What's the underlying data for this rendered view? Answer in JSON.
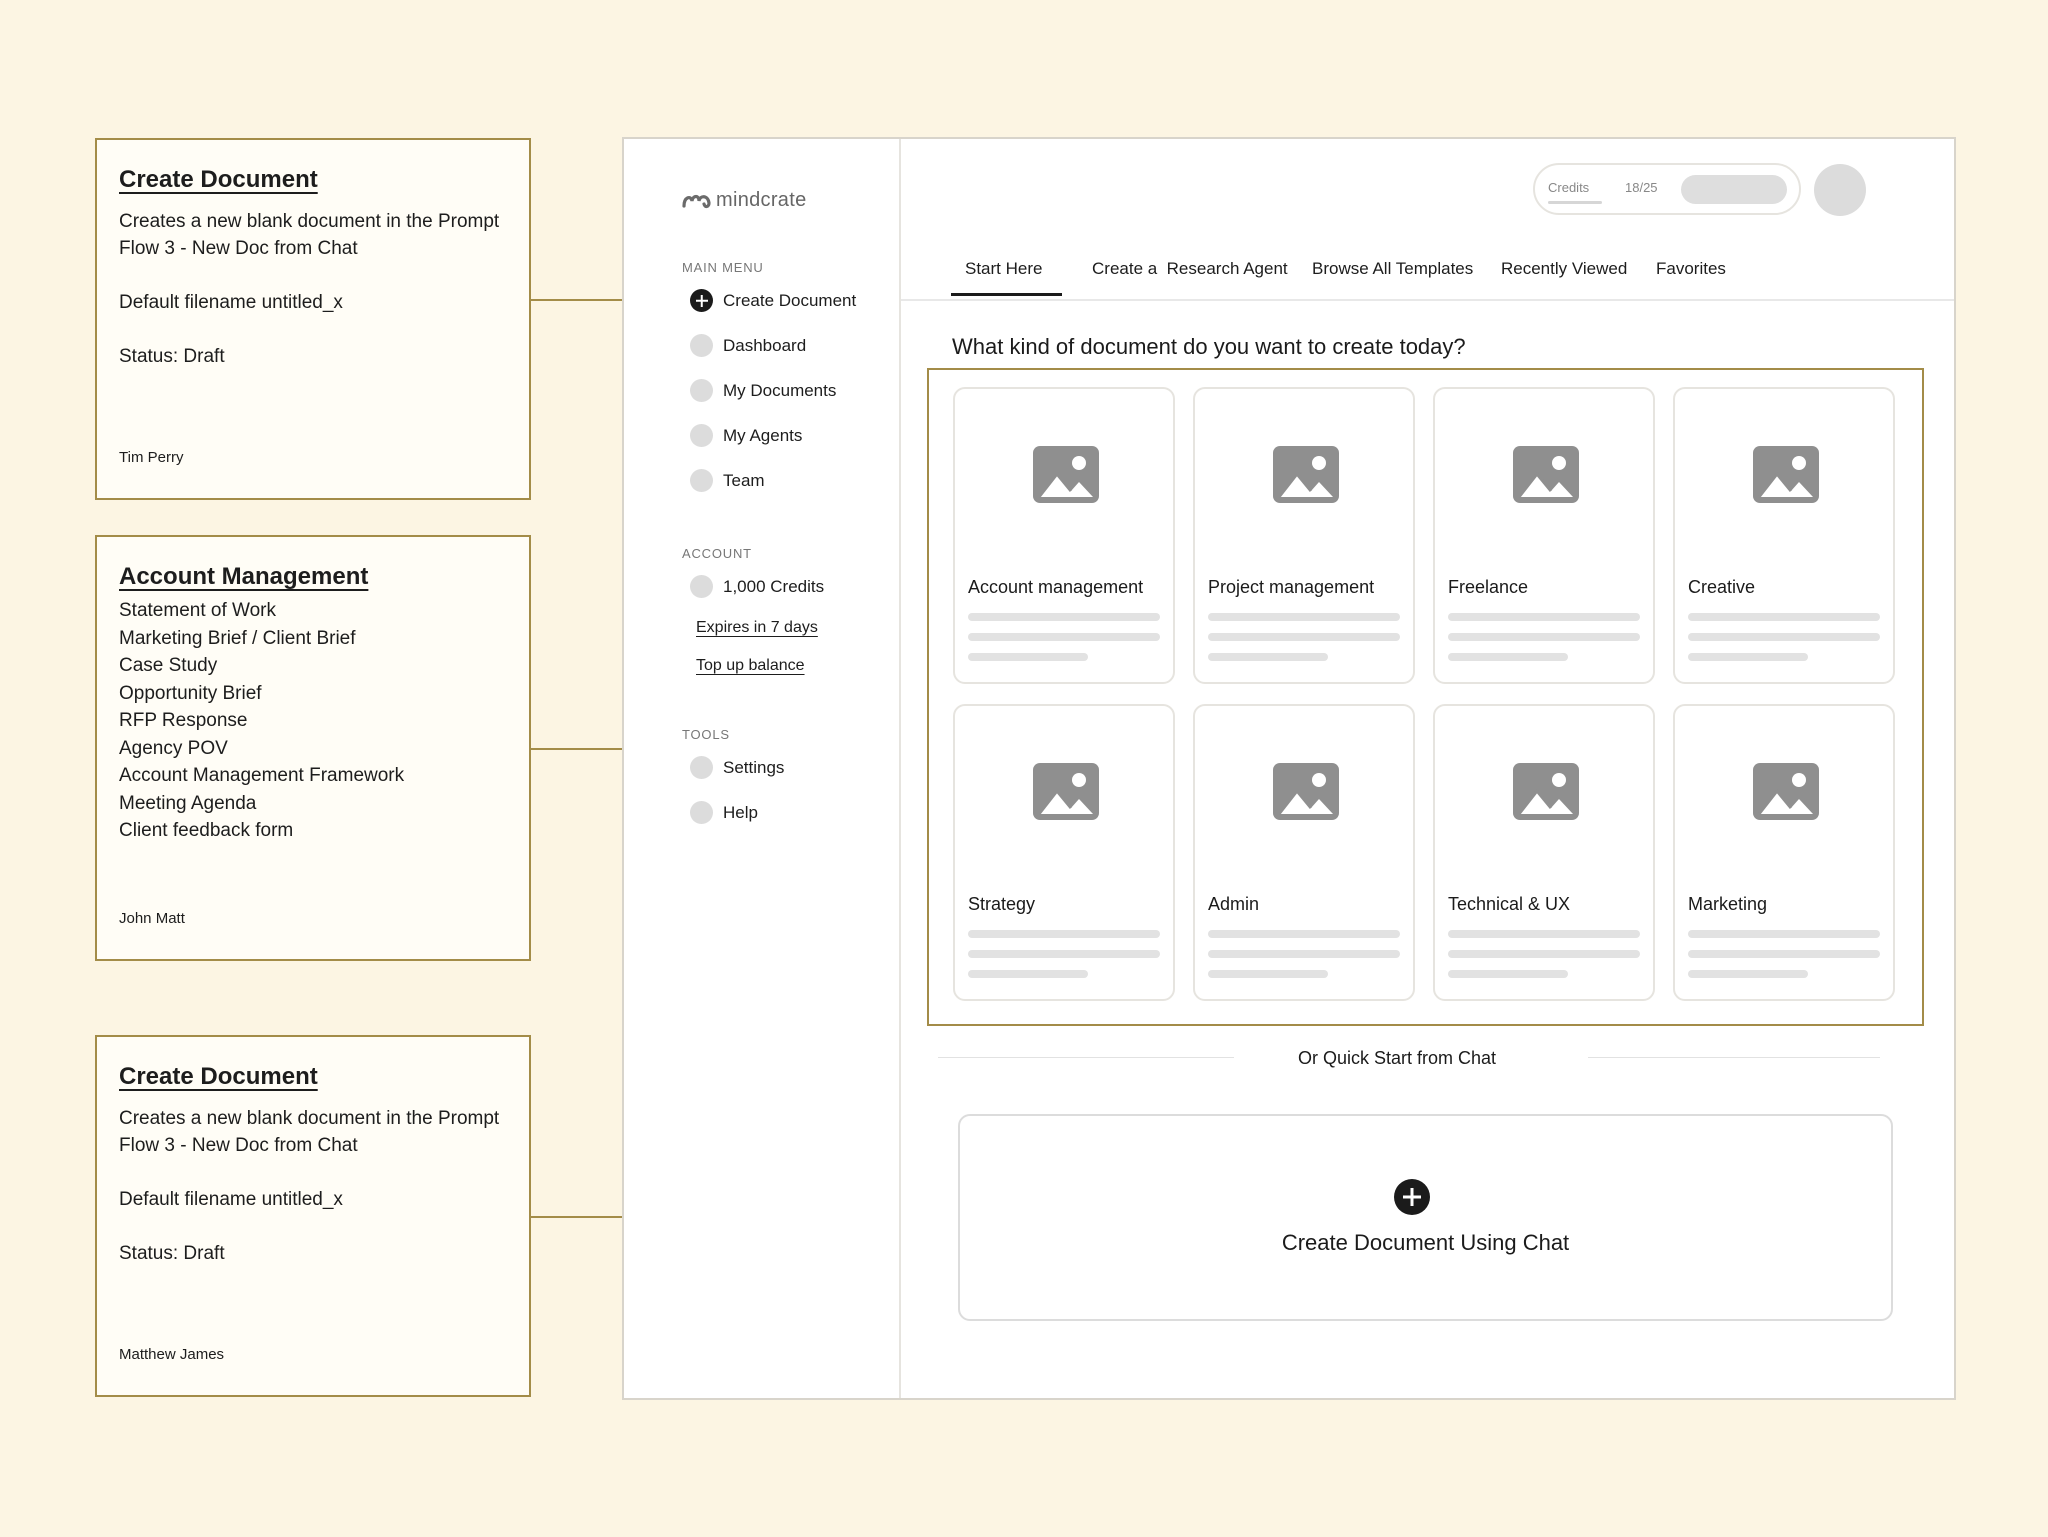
{
  "notes": [
    {
      "title": "Create Document",
      "lines": [
        "Creates a new blank document in the Prompt",
        "Flow 3 - New Doc from Chat",
        "",
        "Default filename untitled_x",
        "",
        "Status: Draft"
      ],
      "author": "Tim Perry"
    },
    {
      "title": "Account Management",
      "lines": [
        "Statement of Work",
        "Marketing Brief / Client Brief",
        "Case Study",
        "Opportunity Brief",
        "RFP Response",
        "Agency POV",
        "Account Management Framework",
        "Meeting Agenda",
        "Client feedback form"
      ],
      "author": "John Matt"
    },
    {
      "title": "Create Document",
      "lines": [
        "Creates a new blank document in the Prompt",
        "Flow 3 - New Doc from Chat",
        "",
        "Default filename untitled_x",
        "",
        "Status: Draft"
      ],
      "author": "Matthew James"
    }
  ],
  "app": {
    "logo_text": "mindcrate",
    "main_menu_label": "MAIN MENU",
    "main_menu": [
      "Create Document",
      "Dashboard",
      "My Documents",
      "My Agents",
      "Team"
    ],
    "account_label": "ACCOUNT",
    "credits_item": "1,000 Credits",
    "expires_link": "Expires in 7 days",
    "top_up_link": "Top up balance",
    "tools_label": "TOOLS",
    "tools": [
      "Settings",
      "Help"
    ]
  },
  "header": {
    "credits_label": "Credits",
    "credits_count": "18/25"
  },
  "tabs": [
    "Start Here",
    "Create a  Research Agent",
    "Browse All Templates",
    "Recently Viewed",
    "Favorites"
  ],
  "question": "What kind of document do you want to create today?",
  "categories": [
    "Account management",
    "Project management",
    "Freelance",
    "Creative",
    "Strategy",
    "Admin",
    "Technical & UX",
    "Marketing"
  ],
  "quick_start_label": "Or Quick Start from Chat",
  "chat_cta": "Create Document Using Chat",
  "icons": {
    "create": "plus-circle-icon",
    "card": "image-placeholder-icon",
    "logo": "mindcrate-logo-icon"
  },
  "colors": {
    "background": "#fcf5e3",
    "annotation": "#a38c48",
    "primary": "#1b1b1b",
    "placeholder": "#8f8f8f"
  }
}
